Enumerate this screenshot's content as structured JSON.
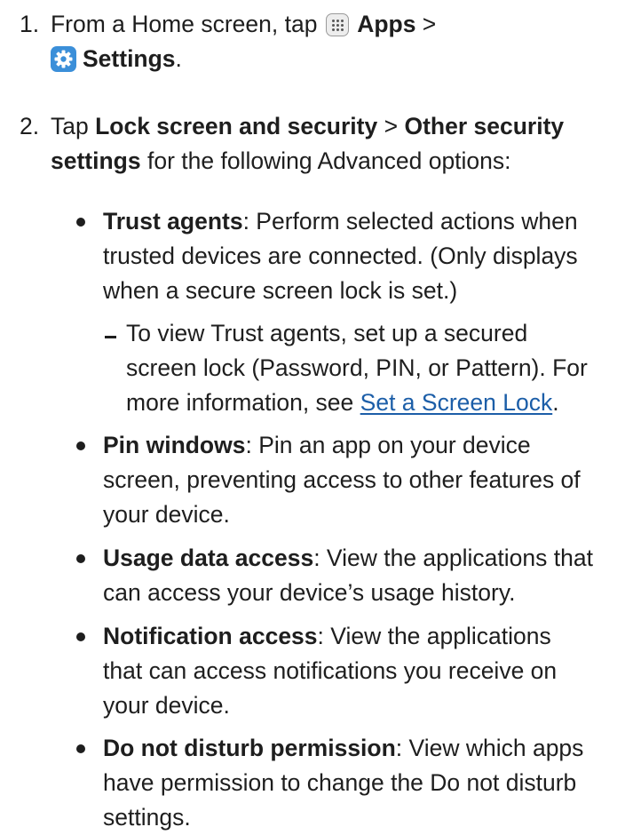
{
  "steps": [
    {
      "num": "1.",
      "lines": [
        [
          {
            "t": "From a Home screen, tap "
          },
          {
            "icon": "apps-icon"
          },
          {
            "t": " "
          },
          {
            "t": "Apps",
            "b": true
          },
          {
            "t": " >"
          }
        ],
        [
          {
            "icon": "settings-icon"
          },
          {
            "t": "Settings",
            "b": true
          },
          {
            "t": "."
          }
        ]
      ]
    },
    {
      "num": "2.",
      "lines": [
        [
          {
            "t": "Tap "
          },
          {
            "t": "Lock screen and security",
            "b": true
          },
          {
            "t": " > "
          },
          {
            "t": "Other security",
            "b": true
          }
        ],
        [
          {
            "t": "settings",
            "b": true
          },
          {
            "t": " for the following Advanced options:"
          }
        ]
      ]
    }
  ],
  "bullets": [
    {
      "lines": [
        [
          {
            "t": "Trust agents",
            "b": true
          },
          {
            "t": ": Perform selected actions when"
          }
        ],
        [
          {
            "t": "trusted devices are connected. (Only displays"
          }
        ],
        [
          {
            "t": "when a secure screen lock is set.)"
          }
        ]
      ],
      "sub": [
        {
          "lines": [
            [
              {
                "t": "To view Trust agents, set up a secured"
              }
            ],
            [
              {
                "t": "screen lock (Password, PIN, or Pattern). For"
              }
            ],
            [
              {
                "t": "more information, see "
              },
              {
                "t": "Set a Screen Lock",
                "link": true
              },
              {
                "t": "."
              }
            ]
          ]
        }
      ]
    },
    {
      "lines": [
        [
          {
            "t": "Pin windows",
            "b": true
          },
          {
            "t": ": Pin an app on your device"
          }
        ],
        [
          {
            "t": "screen, preventing access to other features of"
          }
        ],
        [
          {
            "t": "your device."
          }
        ]
      ]
    },
    {
      "lines": [
        [
          {
            "t": "Usage data access",
            "b": true
          },
          {
            "t": ": View the applications that"
          }
        ],
        [
          {
            "t": "can access your device’s usage history."
          }
        ]
      ]
    },
    {
      "lines": [
        [
          {
            "t": "Notification access",
            "b": true
          },
          {
            "t": ": View the applications"
          }
        ],
        [
          {
            "t": "that can access notifications you receive on"
          }
        ],
        [
          {
            "t": "your device."
          }
        ]
      ]
    },
    {
      "lines": [
        [
          {
            "t": "Do not disturb permission",
            "b": true
          },
          {
            "t": ": View which apps"
          }
        ],
        [
          {
            "t": "have permission to change the Do not disturb"
          }
        ],
        [
          {
            "t": "settings."
          }
        ]
      ]
    }
  ]
}
